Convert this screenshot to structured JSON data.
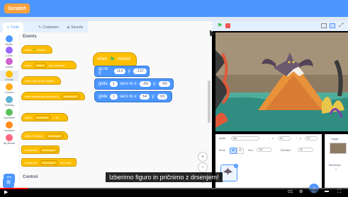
{
  "app": {
    "logo_text": "Scratch"
  },
  "editor_tabs": [
    {
      "label": "Code",
      "active": true
    },
    {
      "label": "Costumes",
      "active": false
    },
    {
      "label": "Sounds",
      "active": false
    }
  ],
  "categories": [
    {
      "label": "Motion",
      "color": "#4c97ff"
    },
    {
      "label": "Looks",
      "color": "#9966ff"
    },
    {
      "label": "Sound",
      "color": "#cf63cf"
    },
    {
      "label": "Events",
      "color": "#ffbf00"
    },
    {
      "label": "Control",
      "color": "#ffab19"
    },
    {
      "label": "Sensing",
      "color": "#5cb1d6"
    },
    {
      "label": "Operators",
      "color": "#59c059"
    },
    {
      "label": "Variables",
      "color": "#ff8c1a"
    },
    {
      "label": "My Blocks",
      "color": "#ff6680"
    }
  ],
  "palette": {
    "section_title": "Events",
    "section_title_2": "Control",
    "blocks": [
      {
        "text": "when",
        "arg": "clicked",
        "hat": true
      },
      {
        "text": "when",
        "arg": "space",
        "suffix": "key pressed",
        "hat": true
      },
      {
        "text": "when this sprite clicked",
        "hat": true
      },
      {
        "text": "when backdrop switches to",
        "arg": "backdrop1",
        "hat": true
      },
      {
        "text": "when",
        "arg": "loudness",
        "suffix": ">  10",
        "hat": true
      },
      {
        "text": "when I receive",
        "arg": "message1",
        "hat": true
      },
      {
        "text": "broadcast",
        "arg": "message1",
        "hat": false
      },
      {
        "text": "broadcast",
        "arg": "message1",
        "suffix": "and wait",
        "hat": false
      }
    ]
  },
  "script": {
    "hat_text": "when",
    "hat_suffix": "clicked",
    "goto_label": "go to x:",
    "goto_x": "114",
    "goto_y_label": "y:",
    "goto_y": "-137",
    "glide1_label": "glide",
    "glide1_secs": "1",
    "glide1_mid": "secs to x:",
    "glide1_x": "-89",
    "glide1_y_label": "y:",
    "glide1_y": "-49",
    "glide2_label": "glide",
    "glide2_secs": "1",
    "glide2_mid": "secs to x:",
    "glide2_x": "54",
    "glide2_y_label": "y:",
    "glide2_y": "93"
  },
  "sprite_info": {
    "sprite_label": "Sprite",
    "sprite_name": "Bat",
    "x_label": "x",
    "x_value": "54",
    "y_label": "y",
    "y_value": "93",
    "show_label": "Show",
    "size_label": "Size",
    "size_value": "100",
    "direction_label": "Direction",
    "direction_value": "90"
  },
  "stage_pane": {
    "title": "Stage",
    "backdrops_label": "Backdrops",
    "backdrops_count": "1"
  },
  "subtitle": "Izberimo figuro in pričnimo z drsenjem!",
  "video": {
    "progress": 0.08
  },
  "colors": {
    "topbar": "#4c97ff",
    "events": "#ffbf00",
    "motion": "#4c97ff"
  }
}
